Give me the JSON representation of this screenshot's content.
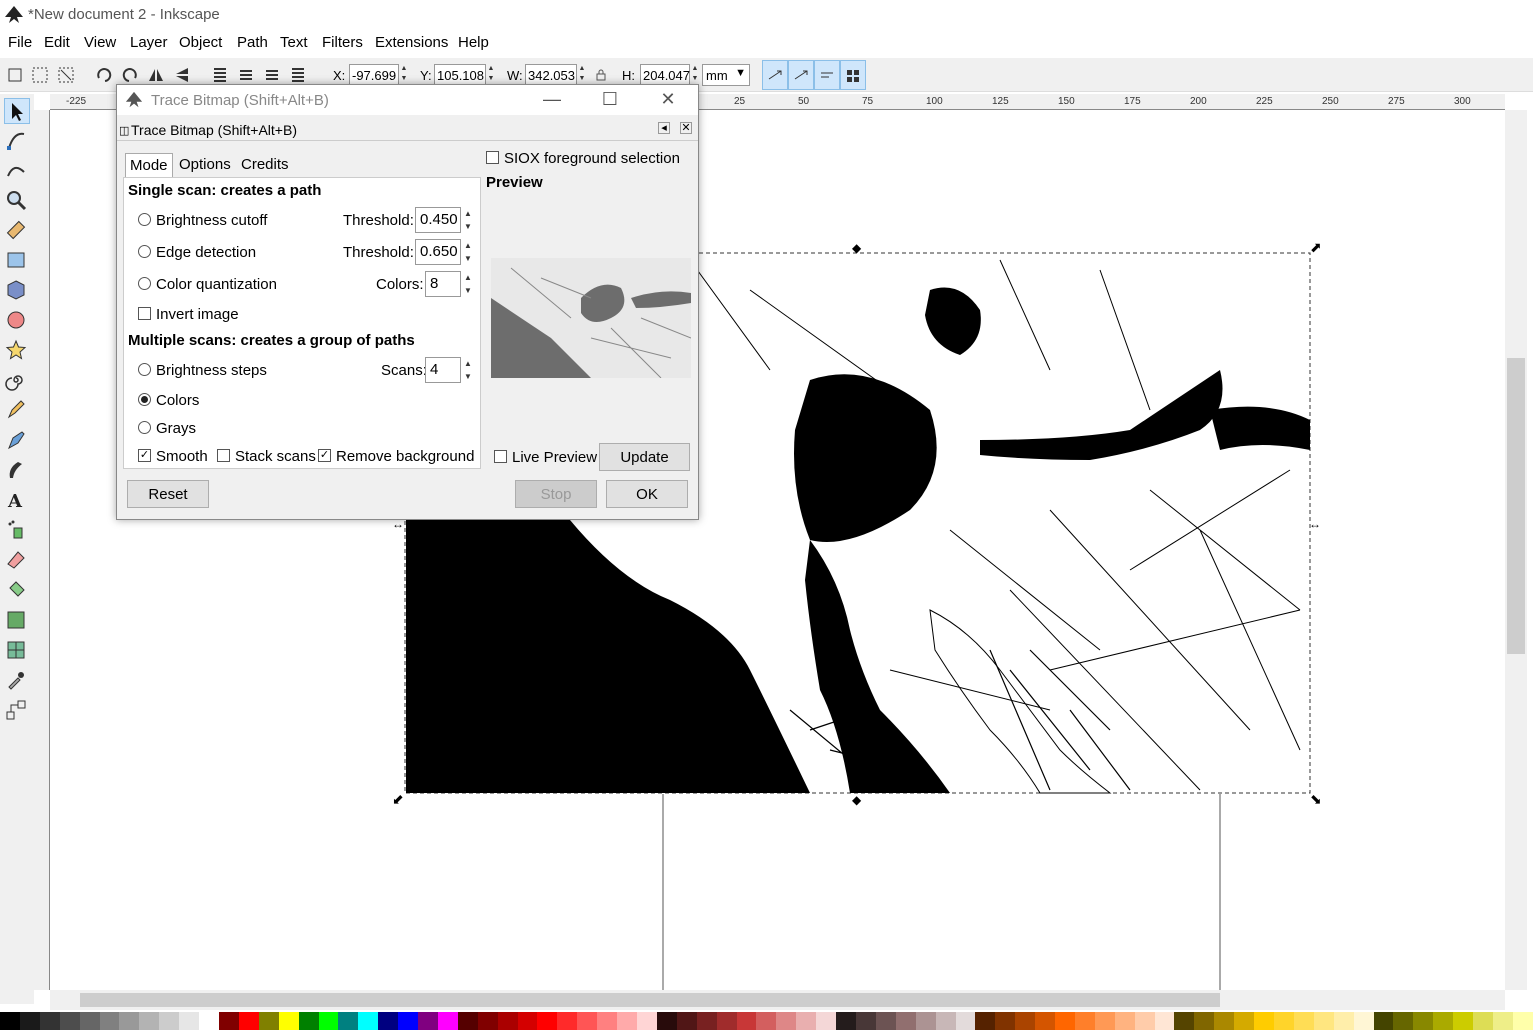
{
  "window": {
    "title": "*New document 2 - Inkscape"
  },
  "menu": [
    "File",
    "Edit",
    "View",
    "Layer",
    "Object",
    "Path",
    "Text",
    "Filters",
    "Extensions",
    "Help"
  ],
  "toolbar": {
    "x_label": "X:",
    "x_value": "-97.699",
    "y_label": "Y:",
    "y_value": "105.108",
    "w_label": "W:",
    "w_value": "342.053",
    "h_label": "H:",
    "h_value": "204.047",
    "unit": "mm"
  },
  "ruler": [
    "-225",
    "25",
    "50",
    "75",
    "100",
    "125",
    "150",
    "175",
    "200",
    "225",
    "250",
    "275",
    "300"
  ],
  "dialog": {
    "title": "Trace Bitmap (Shift+Alt+B)",
    "inner_title": "Trace Bitmap (Shift+Alt+B)",
    "tabs": [
      "Mode",
      "Options",
      "Credits"
    ],
    "single_scan_heading": "Single scan: creates a path",
    "brightness_cutoff": "Brightness cutoff",
    "threshold_label": "Threshold:",
    "brightness_threshold": "0.450",
    "edge_detection": "Edge detection",
    "threshold_label_2": "Threshold:",
    "edge_threshold": "0.650",
    "color_quantization": "Color quantization",
    "colors_label": "Colors:",
    "colors_value": "8",
    "invert_image": "Invert image",
    "multiple_scans_heading": "Multiple scans: creates a group of paths",
    "brightness_steps": "Brightness steps",
    "scans_label": "Scans:",
    "scans_value": "4",
    "colors_option": "Colors",
    "grays_option": "Grays",
    "smooth": "Smooth",
    "stack_scans": "Stack scans",
    "remove_background": "Remove background",
    "siox": "SIOX foreground selection",
    "preview_heading": "Preview",
    "live_preview": "Live Preview",
    "update_button": "Update",
    "reset_button": "Reset",
    "stop_button": "Stop",
    "ok_button": "OK"
  },
  "palette": [
    "#000000",
    "#1a1a1a",
    "#333333",
    "#4d4d4d",
    "#666666",
    "#808080",
    "#999999",
    "#b3b3b3",
    "#cccccc",
    "#e6e6e6",
    "#ffffff",
    "#800000",
    "#ff0000",
    "#808000",
    "#ffff00",
    "#008000",
    "#00ff00",
    "#008080",
    "#00ffff",
    "#000080",
    "#0000ff",
    "#800080",
    "#ff00ff",
    "#550000",
    "#800000",
    "#aa0000",
    "#d40000",
    "#ff0000",
    "#ff2a2a",
    "#ff5555",
    "#ff8080",
    "#ffaaaa",
    "#ffd5d5",
    "#280b0b",
    "#501616",
    "#782121",
    "#a02c2c",
    "#c83737",
    "#d35f5f",
    "#de8787",
    "#e9afaf",
    "#f4d7d7",
    "#241c1c",
    "#483737",
    "#6c5353",
    "#916f6f",
    "#ac9393",
    "#c8b7b7",
    "#e3dbdb",
    "#552200",
    "#803300",
    "#aa4400",
    "#d45500",
    "#ff6600",
    "#ff7f2a",
    "#ff9955",
    "#ffb380",
    "#ffccaa",
    "#ffe6d5",
    "#554400",
    "#806600",
    "#aa8800",
    "#d4aa00",
    "#ffcc00",
    "#ffd42a",
    "#ffdd55",
    "#ffe680",
    "#ffeeaa",
    "#fff6d5",
    "#444400",
    "#666600",
    "#888800",
    "#aaaa00",
    "#cccc00",
    "#dddd55",
    "#eeee88",
    "#ffffaa"
  ]
}
